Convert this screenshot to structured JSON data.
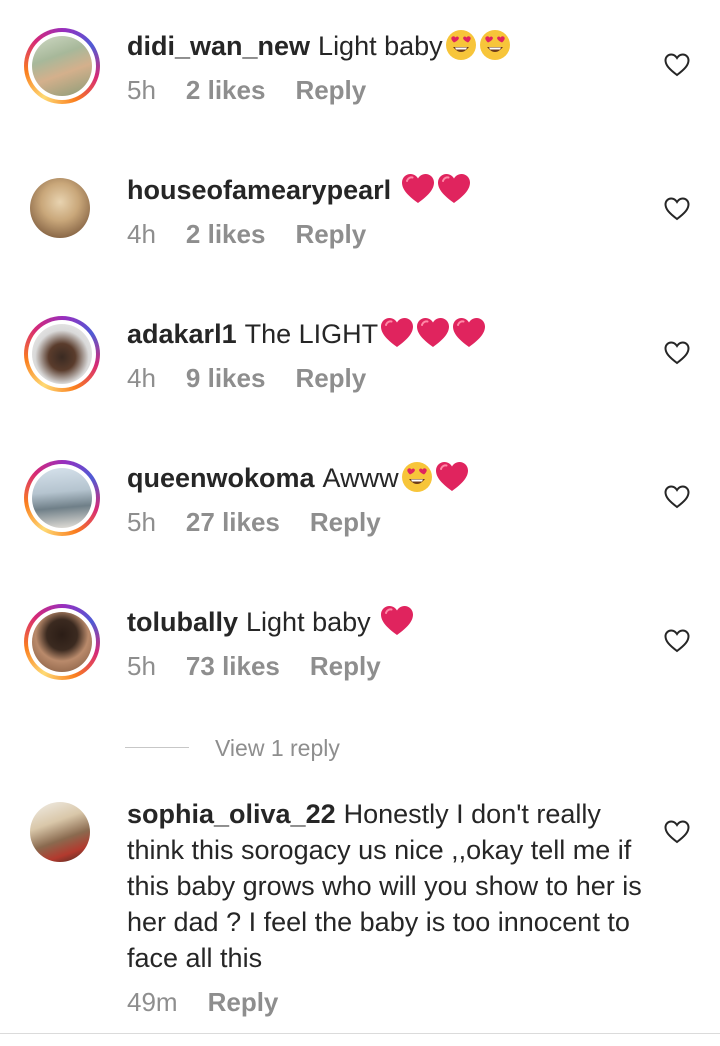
{
  "comments": [
    {
      "username": "didi_wan_new",
      "text": "Light baby",
      "time": "5h",
      "likes": "2 likes",
      "reply": "Reply",
      "avatar_ring": true
    },
    {
      "username": "houseofamearypearl",
      "text": "",
      "time": "4h",
      "likes": "2 likes",
      "reply": "Reply",
      "avatar_ring": false
    },
    {
      "username": "adakarl1",
      "text": "The LIGHT",
      "time": "4h",
      "likes": "9 likes",
      "reply": "Reply",
      "avatar_ring": true
    },
    {
      "username": "queenwokoma",
      "text": "Awww",
      "time": "5h",
      "likes": "27 likes",
      "reply": "Reply",
      "avatar_ring": true
    },
    {
      "username": "tolubally",
      "text": "Light baby",
      "time": "5h",
      "likes": "73 likes",
      "reply": "Reply",
      "avatar_ring": true
    },
    {
      "username": "sophia_oliva_22",
      "text": "Honestly I don't really think this sorogacy us nice ,,okay tell me if this baby grows who will you show to her is her dad ? I feel the baby is too innocent to face all this",
      "time": "49m",
      "reply": "Reply",
      "avatar_ring": false
    }
  ],
  "view_replies_label": "View 1 reply",
  "colors": {
    "text": "#262626",
    "muted": "#8e8e8e",
    "heart_emoji": "#e0245e",
    "ring_start": "#feda75",
    "ring_end": "#962fbf"
  },
  "icons": {
    "like": "heart-outline-icon",
    "heart_emoji": "red-heart-emoji",
    "face_emoji": "heart-eyes-emoji"
  }
}
